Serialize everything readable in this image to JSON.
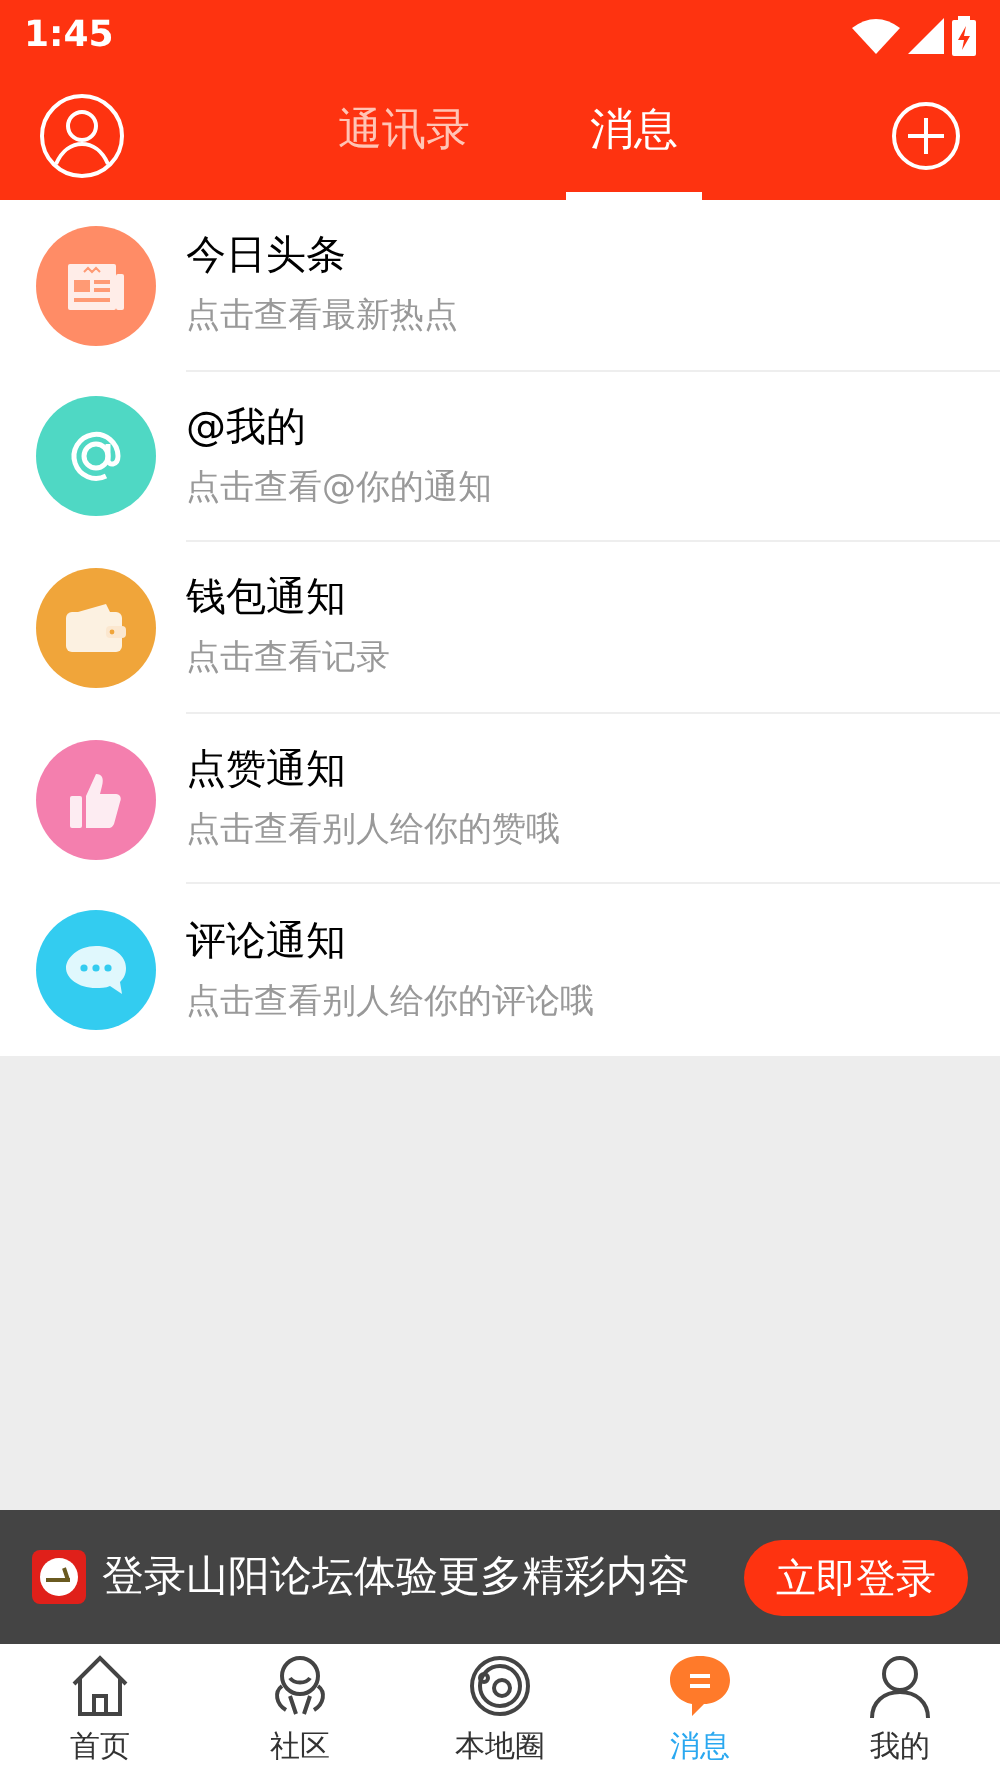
{
  "status_bar": {
    "time": "1:45"
  },
  "header": {
    "tabs": [
      {
        "label": "通讯录",
        "selected": false
      },
      {
        "label": "消息",
        "selected": true
      }
    ]
  },
  "messages": [
    {
      "kind": "news",
      "color": "#ff8c66",
      "title": "今日头条",
      "subtitle": "点击查看最新热点"
    },
    {
      "kind": "mention",
      "color": "#4fd8c4",
      "title": "@我的",
      "subtitle": "点击查看@你的通知"
    },
    {
      "kind": "wallet",
      "color": "#f0a53a",
      "title": "钱包通知",
      "subtitle": "点击查看记录"
    },
    {
      "kind": "like",
      "color": "#f47fae",
      "title": "点赞通知",
      "subtitle": "点击查看别人给你的赞哦"
    },
    {
      "kind": "comment",
      "color": "#33ccf0",
      "title": "评论通知",
      "subtitle": "点击查看别人给你的评论哦"
    }
  ],
  "login_banner": {
    "text": "登录山阳论坛体验更多精彩内容",
    "button": "立即登录"
  },
  "bottom_nav": [
    {
      "kind": "home",
      "label": "首页",
      "selected": false
    },
    {
      "kind": "community",
      "label": "社区",
      "selected": false
    },
    {
      "kind": "local",
      "label": "本地圈",
      "selected": false
    },
    {
      "kind": "messages",
      "label": "消息",
      "selected": true
    },
    {
      "kind": "profile",
      "label": "我的",
      "selected": false
    }
  ]
}
